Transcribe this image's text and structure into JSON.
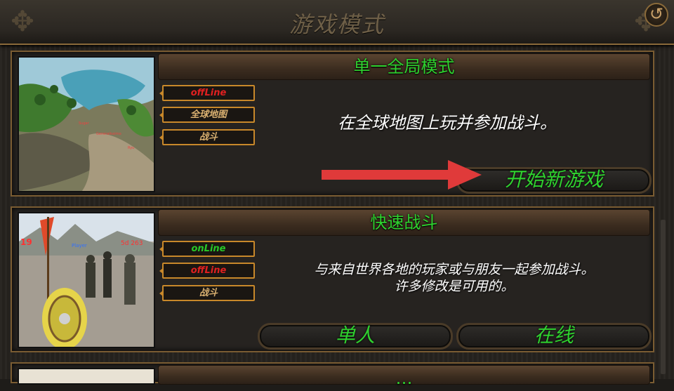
{
  "window": {
    "title": "游戏模式"
  },
  "panels": [
    {
      "header": "单一全局模式",
      "tags": [
        "offLine",
        "全球地图",
        "战斗"
      ],
      "description": "在全球地图上玩并参加战斗。",
      "button": "开始新游戏"
    },
    {
      "header": "快速战斗",
      "tags": [
        "onLine",
        "offLine",
        "战斗"
      ],
      "description_line1": "与来自世界各地的玩家或与朋友一起参加战斗。",
      "description_line2": "许多修改是可用的。",
      "buttons": [
        "单人",
        "在线"
      ]
    },
    {
      "header": "…"
    }
  ],
  "colors": {
    "accent_green": "#2fd22f",
    "tag_red": "#e02020",
    "tag_green": "#28c828",
    "border_gold": "#c8882a",
    "arrow_red": "#e03a3a"
  },
  "icons": {
    "back": "back-arrow-icon"
  }
}
